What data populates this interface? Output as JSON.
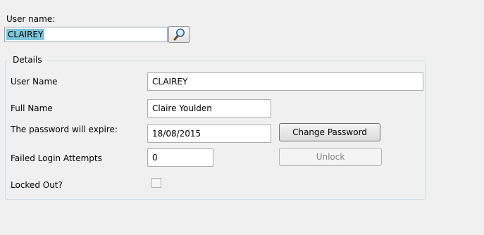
{
  "lookup": {
    "label": "User name:",
    "value": "CLAIREY",
    "button_icon": "magnifier-icon"
  },
  "details": {
    "legend": "Details",
    "user_name": {
      "label": "User Name",
      "value": "CLAIREY"
    },
    "full_name": {
      "label": "Full Name",
      "value": "Claire Youlden"
    },
    "password_expiry": {
      "label": "The password will expire:",
      "value": "18/08/2015"
    },
    "change_password_label": "Change Password",
    "failed_logins": {
      "label": "Failed Login Attempts",
      "value": "0"
    },
    "unlock_label": "Unlock",
    "locked_out": {
      "label": "Locked Out?",
      "checked": false
    }
  },
  "colors": {
    "selection": "#7fc7dd",
    "background": "#f0f0f0"
  }
}
